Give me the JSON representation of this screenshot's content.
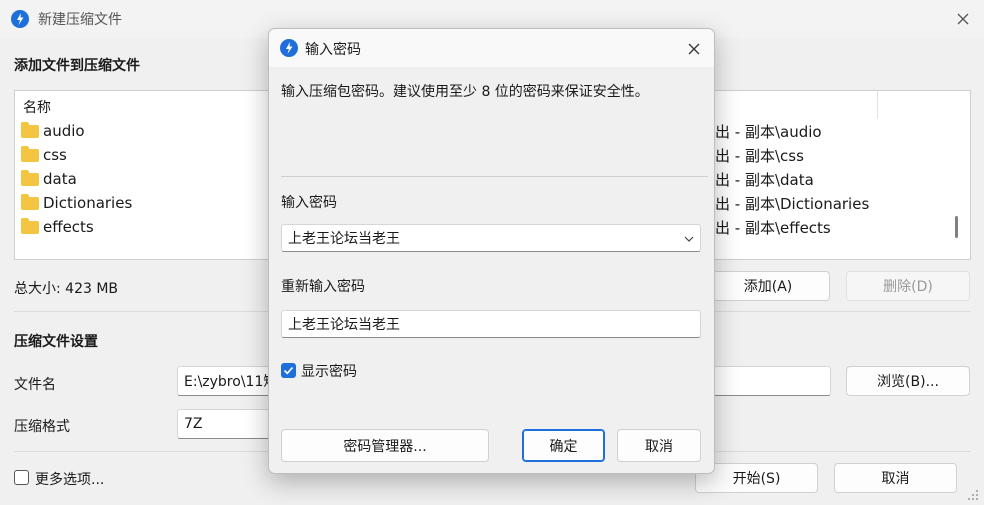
{
  "main_window": {
    "title": "新建压缩文件",
    "add_files_section_title": "添加文件到压缩文件",
    "file_list": {
      "column_name": "名称",
      "items": [
        "audio",
        "css",
        "data",
        "Dictionaries",
        "effects"
      ],
      "path_items": [
        "出 - 副本\\audio",
        "出 - 副本\\css",
        "出 - 副本\\data",
        "出 - 副本\\Dictionaries",
        "出 - 副本\\effects"
      ]
    },
    "total_size": "总大小: 423 MB",
    "add_button": "添加(A)",
    "delete_button": "删除(D)",
    "settings_section_title": "压缩文件设置",
    "filename_label": "文件名",
    "filename_value": "E:\\zybro\\11短",
    "browse_button": "浏览(B)...",
    "format_label": "压缩格式",
    "format_value": "7Z",
    "more_options_label": "更多选项...",
    "more_options_checked": false,
    "start_button": "开始(S)",
    "cancel_button": "取消"
  },
  "password_dialog": {
    "title": "输入密码",
    "description": "输入压缩包密码。建议使用至少 8 位的密码来保证安全性。",
    "password_label": "输入密码",
    "password_value": "上老王论坛当老王",
    "confirm_label": "重新输入密码",
    "confirm_value": "上老王论坛当老王",
    "show_password_label": "显示密码",
    "show_password_checked": true,
    "manager_button": "密码管理器...",
    "ok_button": "确定",
    "cancel_button": "取消"
  },
  "colors": {
    "accent": "#1e6fd9",
    "window_bg": "#f0f0f0"
  },
  "icons": [
    "app-logo-icon",
    "close-icon",
    "folder-icon",
    "chevron-down-icon",
    "checkmark-icon",
    "resize-grip-icon"
  ]
}
